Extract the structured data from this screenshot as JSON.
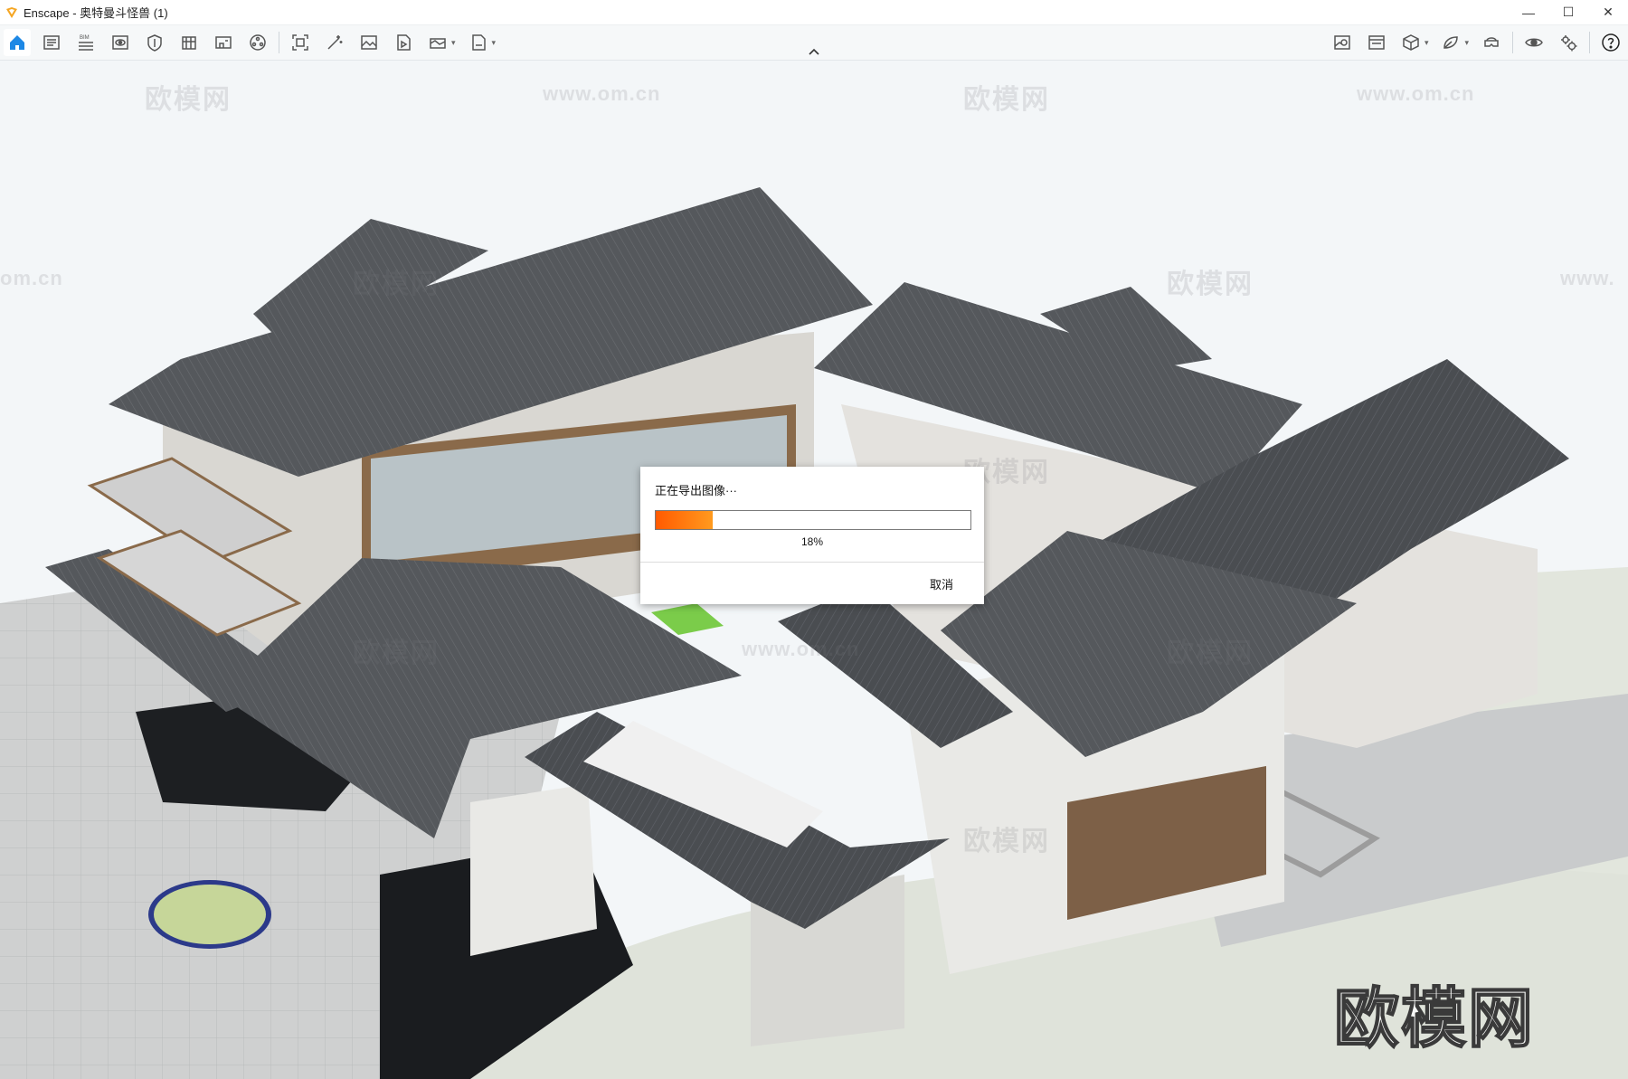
{
  "window": {
    "app_name": "Enscape",
    "title": "Enscape - 奥特曼斗怪兽 (1)",
    "controls": {
      "minimize": "—",
      "maximize": "☐",
      "close": "✕"
    }
  },
  "toolbar": {
    "left_tools": [
      "home-icon",
      "capture-list-icon",
      "bim-icon",
      "visual-settings-icon",
      "atmosphere-icon",
      "material-editor-icon",
      "asset-library-icon",
      "site-context-icon",
      "screenshot-icon",
      "batch-render-icon",
      "gallery-icon",
      "video-editor-icon",
      "panorama-icon",
      "export-icon"
    ],
    "right_tools": [
      "view-management-icon",
      "image-capture-icon",
      "3d-cube-icon",
      "feedback-icon",
      "vr-headset-icon",
      "visibility-icon",
      "settings-icon",
      "help-icon"
    ],
    "bim_label": "BIM"
  },
  "watermarks": {
    "brand": "欧模网",
    "url": "www.om.cn",
    "url_short": "om.cn",
    "url_prefix": "www."
  },
  "dialog": {
    "title": "正在导出图像···",
    "progress_percent": 18,
    "progress_label": "18%",
    "cancel_label": "取消"
  },
  "colors": {
    "progress_start": "#ff5a00",
    "progress_end": "#ff9a1e",
    "accent": "#1e88e5",
    "logo": "#f5a623"
  }
}
